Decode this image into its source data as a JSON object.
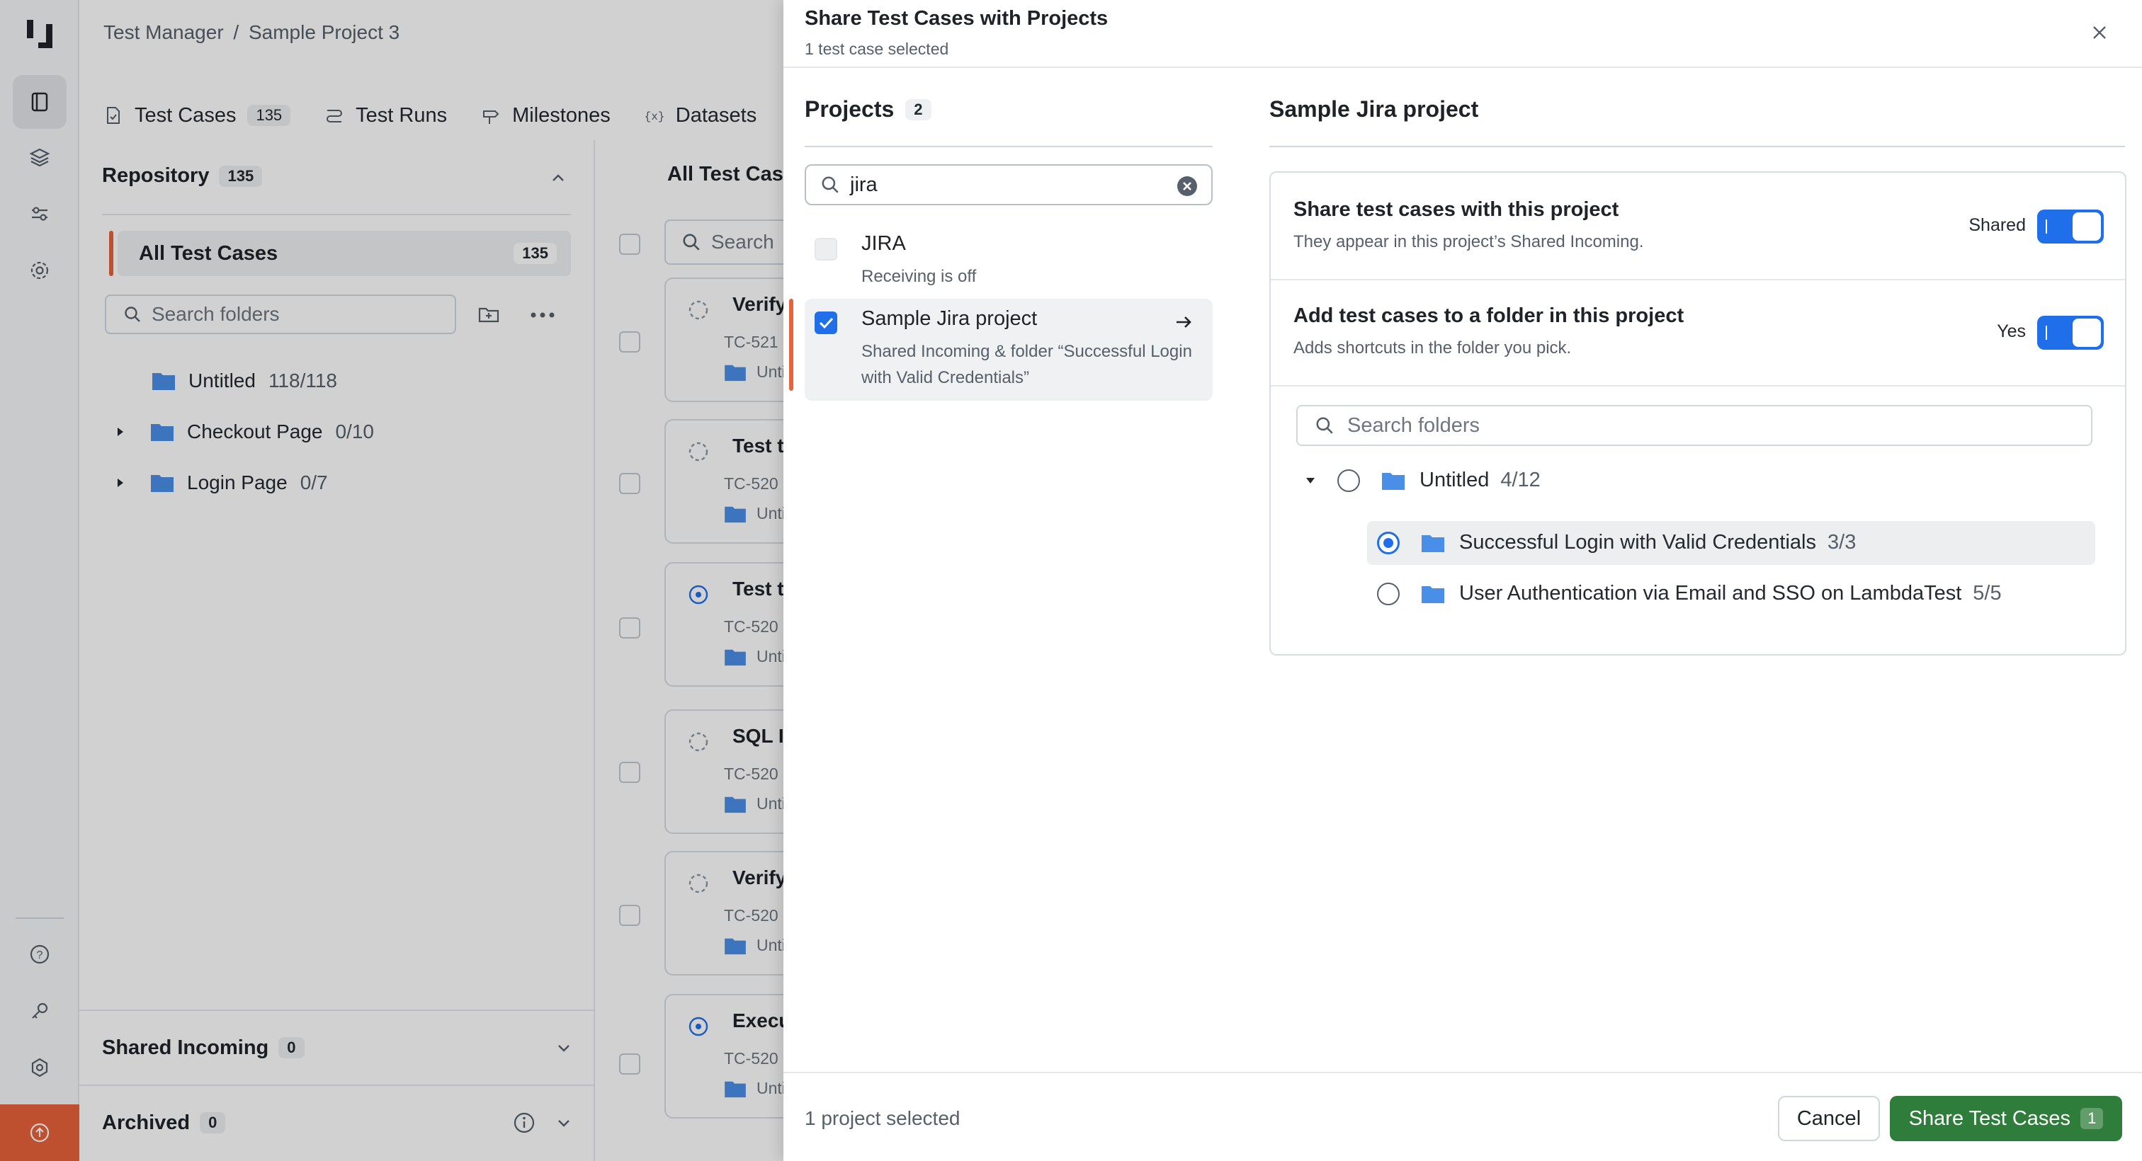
{
  "app": {
    "breadcrumb": {
      "root": "Test Manager",
      "sep": "/",
      "project": "Sample Project 3"
    },
    "tabs": [
      {
        "label": "Test Cases",
        "count": "135"
      },
      {
        "label": "Test Runs"
      },
      {
        "label": "Milestones"
      },
      {
        "label": "Datasets"
      }
    ],
    "repository": {
      "title": "Repository",
      "count": "135",
      "all_label": "All Test Cases",
      "all_count": "135",
      "search_placeholder": "Search folders",
      "folders": [
        {
          "name": "Untitled",
          "count": "118/118"
        },
        {
          "name": "Checkout Page",
          "count": "0/10"
        },
        {
          "name": "Login Page",
          "count": "0/7"
        }
      ],
      "shared_incoming": {
        "label": "Shared Incoming",
        "count": "0"
      },
      "archived": {
        "label": "Archived",
        "count": "0"
      }
    },
    "list": {
      "title": "All Test Cases",
      "search_placeholder": "Search",
      "cards": [
        {
          "title": "Verify",
          "id": "TC-521",
          "folder": "Untitled"
        },
        {
          "title": "Test t",
          "id": "TC-520",
          "folder": "Untitled"
        },
        {
          "title": "Test t",
          "id": "TC-520",
          "folder": "Untitled"
        },
        {
          "title": "SQL I",
          "id": "TC-520",
          "folder": "Untitled"
        },
        {
          "title": "Verify",
          "id": "TC-520",
          "folder": "Untitled"
        },
        {
          "title": "Execu",
          "id": "TC-520",
          "folder": "Untitled"
        }
      ]
    }
  },
  "modal": {
    "title": "Share Test Cases with Projects",
    "subtitle": "1 test case selected",
    "projects": {
      "heading": "Projects",
      "count": "2",
      "search_value": "jira",
      "items": [
        {
          "name": "JIRA",
          "desc": "Receiving is off",
          "checked": false
        },
        {
          "name": "Sample Jira project",
          "desc": "Shared Incoming & folder “Successful Login with Valid Credentials”",
          "checked": true
        }
      ]
    },
    "detail": {
      "title": "Sample Jira project",
      "share_option": {
        "heading": "Share test cases with this project",
        "desc": "They appear in this project’s Shared Incoming.",
        "state_label": "Shared"
      },
      "folder_option": {
        "heading": "Add test cases to a folder in this project",
        "desc": "Adds shortcuts in the folder you pick.",
        "state_label": "Yes"
      },
      "folder_search_placeholder": "Search folders",
      "folders": [
        {
          "name": "Untitled",
          "count": "4/12"
        },
        {
          "name": "Successful Login with Valid Credentials",
          "count": "3/3"
        },
        {
          "name": "User Authentication via Email and SSO on LambdaTest",
          "count": "5/5"
        }
      ]
    },
    "footer": {
      "status": "1 project selected",
      "cancel_label": "Cancel",
      "share_label": "Share Test Cases",
      "share_count": "1"
    }
  },
  "colors": {
    "accent": "#e8623a",
    "primary": "#1f6feb",
    "success": "#2f7d3a"
  }
}
